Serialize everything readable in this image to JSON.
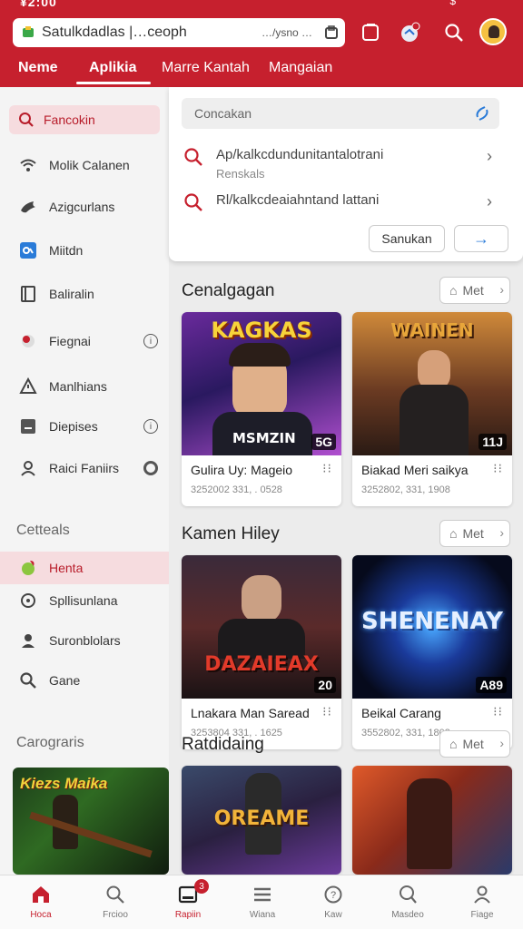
{
  "status": {
    "time": "¥2:00",
    "right": "$"
  },
  "topbar": {
    "url_text": "Satulkdadlas |…ceoph",
    "url_suffix": "…/ysno …"
  },
  "topnav": {
    "items": [
      {
        "label": "Neme"
      },
      {
        "label": "Aplikia"
      },
      {
        "label": "Marre Kantah"
      },
      {
        "label": "Mangaian"
      }
    ]
  },
  "sidebar": {
    "search_label": "Fancokin",
    "items": [
      {
        "label": "Molik Calanen",
        "icon": "wifi-icon"
      },
      {
        "label": "Azigcurlans",
        "icon": "bird-icon"
      },
      {
        "label": "Miitdn",
        "icon": "qr-icon"
      },
      {
        "label": "Baliralin",
        "icon": "book-icon"
      },
      {
        "label": "Fiegnai",
        "icon": "record-icon"
      },
      {
        "label": "Manlhians",
        "icon": "warning-icon"
      },
      {
        "label": "Diepises",
        "icon": "minus-box-icon"
      },
      {
        "label": "Raici Faniirs",
        "icon": "person-icon"
      }
    ],
    "section1": "Cetteals",
    "section1_items": [
      {
        "label": "Henta",
        "icon": "leaf-icon"
      },
      {
        "label": "Spllisunlana",
        "icon": "help-icon"
      },
      {
        "label": "Suronblolars",
        "icon": "user-icon"
      },
      {
        "label": "Gane",
        "icon": "search-icon"
      }
    ],
    "section2": "Carograris",
    "thumb_title": "Kiezs Maika"
  },
  "dropdown": {
    "placeholder": "Concakan",
    "suggestions": [
      {
        "text": "Ap/kalkcdundunitantalotrani",
        "sub": "Renskals"
      },
      {
        "text": "Rl/kalkcdeaiahntand lattani",
        "sub": ""
      }
    ],
    "btn_primary": "Sanukan",
    "btn_arrow": "→"
  },
  "sections": [
    {
      "title": "Cenalgagan",
      "more": "Met",
      "cards": [
        {
          "name": "Gulira Uy: Mageio",
          "meta": "3252002 331, . 0528",
          "badge": "5G",
          "poster": "KAGKAS",
          "poster_sub": "MSMZIN"
        },
        {
          "name": "Biakad Meri saikya",
          "meta": "3252802, 331, 1908",
          "badge": "11J",
          "poster": "WAINEN",
          "poster_sub": ""
        }
      ]
    },
    {
      "title": "Kamen Hiley",
      "more": "Met",
      "cards": [
        {
          "name": "Lnakara Man Saread",
          "meta": "3253804 331, . 1625",
          "badge": "20",
          "poster": "DAZAIEAX",
          "poster_sub": ""
        },
        {
          "name": "Beikal Carang",
          "meta": "3552802, 331, 1803",
          "badge": "A89",
          "poster": "SHENENAY",
          "poster_sub": ""
        }
      ]
    },
    {
      "title": "Ratdidaing",
      "more": "Met",
      "cards": [
        {
          "name": "",
          "meta": "",
          "badge": "",
          "poster": "OREAME",
          "poster_sub": ""
        },
        {
          "name": "",
          "meta": "",
          "badge": "",
          "poster": "",
          "poster_sub": ""
        }
      ]
    }
  ],
  "bottomnav": {
    "items": [
      {
        "label": "Hoca",
        "icon": "home-icon"
      },
      {
        "label": "Frcioo",
        "icon": "search-icon"
      },
      {
        "label": "Rapiin",
        "icon": "inbox-icon",
        "badge": "3"
      },
      {
        "label": "Wiana",
        "icon": "list-icon"
      },
      {
        "label": "Kaw",
        "icon": "help-icon"
      },
      {
        "label": "Masdeo",
        "icon": "search-icon"
      },
      {
        "label": "Fiage",
        "icon": "profile-icon"
      }
    ]
  },
  "colors": {
    "brand": "#c6202e",
    "accent_blue": "#2a7bd8"
  }
}
